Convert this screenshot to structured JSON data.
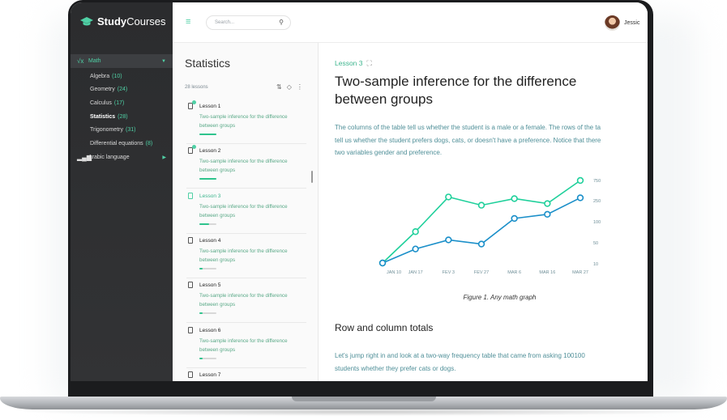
{
  "brand": {
    "name_bold": "Study",
    "name_light": "Courses"
  },
  "sidebar": {
    "items": [
      {
        "icon": "sqrt-icon",
        "label": "Math",
        "active": true
      },
      {
        "icon": "chart-bars-icon",
        "label": "Arabic language",
        "active": false
      }
    ],
    "math_subitems": [
      {
        "label": "Algebra",
        "count": "(10)"
      },
      {
        "label": "Geometry",
        "count": "(24)"
      },
      {
        "label": "Calculus",
        "count": "(17)"
      },
      {
        "label": "Statistics",
        "count": "(28)",
        "selected": true
      },
      {
        "label": "Trigonometry",
        "count": "(31)"
      },
      {
        "label": "Differential equations",
        "count": "(8)"
      }
    ]
  },
  "topbar": {
    "search_placeholder": "Search...",
    "user_name": "Jessic"
  },
  "lessons_panel": {
    "title": "Statistics",
    "count": "28 lessons",
    "lessons": [
      {
        "title": "Lesson 1",
        "desc": "Two-sample inference for the difference between groups",
        "done": true,
        "current": false,
        "progress": 1.0
      },
      {
        "title": "Lesson 2",
        "desc": "Two-sample inference for the difference between groups",
        "done": true,
        "current": false,
        "progress": 1.0
      },
      {
        "title": "Lesson 3",
        "desc": "Two-sample inference for the difference between groups",
        "done": false,
        "current": true,
        "progress": 0.55
      },
      {
        "title": "Lesson 4",
        "desc": "Two-sample inference for the difference between groups",
        "done": false,
        "current": false,
        "progress": 0.2
      },
      {
        "title": "Lesson 5",
        "desc": "Two-sample inference for the difference between groups",
        "done": false,
        "current": false,
        "progress": 0.2
      },
      {
        "title": "Lesson 6",
        "desc": "Two-sample inference for the difference between groups",
        "done": false,
        "current": false,
        "progress": 0.2
      },
      {
        "title": "Lesson 7",
        "desc": "",
        "done": false,
        "current": false,
        "progress": 0
      }
    ]
  },
  "content": {
    "lesson_label": "Lesson 3",
    "title": "Two-sample inference for the difference between groups",
    "para1_lines": [
      "The columns of the table tell us whether the student is a male or a female. The rows of the ta",
      "tell us whether the student prefers dogs, cats, or doesn't have a preference. Notice that there",
      "two variables gender and preference."
    ],
    "caption": "Figure 1. Any math graph",
    "h3": "Row and column totals",
    "para2_lines": [
      "Let's jump right in and look at a two-way frequency table that came from asking 100100",
      "students whether they prefer cats or dogs."
    ]
  },
  "chart_data": {
    "type": "line",
    "categories": [
      "JAN 10",
      "JAN 17",
      "FEV 3",
      "FEV 27",
      "MAR 6",
      "MAR 16",
      "MAR 27"
    ],
    "y_ticks": [
      "750",
      "250",
      "100",
      "50",
      "10"
    ],
    "series": [
      {
        "color": "#1fd09b",
        "values": [
          0,
          0.38,
          0.8,
          0.7,
          0.78,
          0.72,
          1.0
        ]
      },
      {
        "color": "#1a8fc9",
        "values": [
          0,
          0.17,
          0.28,
          0.23,
          0.54,
          0.59,
          0.79
        ]
      }
    ],
    "grid": false
  }
}
